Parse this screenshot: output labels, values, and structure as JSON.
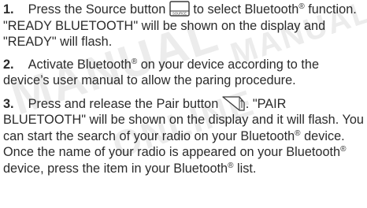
{
  "steps": [
    {
      "number": "1.",
      "text_1": "Press the Source button",
      "icon": "source-button-icon",
      "icon_label": "SOURCE",
      "text_2": "to select Bluetooth",
      "sup_1": "®",
      "text_3": "function. \"READY BLUETOOTH\" will be shown on the display and \"READY\" will flash."
    },
    {
      "number": "2.",
      "text_1": "Activate Bluetooth",
      "sup_1": "®",
      "text_2": "on your device according to the device’s user manual to allow the paring procedure."
    },
    {
      "number": "3.",
      "text_1": "Press and release the Pair button",
      "icon": "pair-button-icon",
      "text_2": ". \"PAIR BLUETOOTH\" will be shown on the display and it will flash. You can start the search of your radio on your Bluetooth",
      "sup_1": "®",
      "text_3": "device. Once the name of your radio is appeared on your Bluetooth",
      "sup_2": "®",
      "text_4": "device, press the item in your Bluetooth",
      "sup_3": "®",
      "text_5": "list."
    }
  ]
}
